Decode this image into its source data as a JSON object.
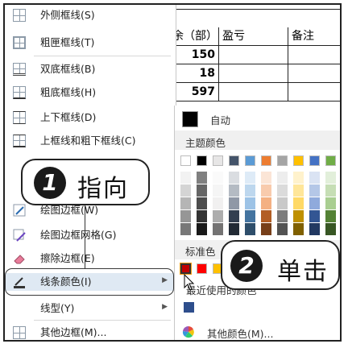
{
  "spreadsheet": {
    "header": [
      "余（部）",
      "盈亏",
      "备注"
    ],
    "rows": [
      [
        "150",
        "",
        ""
      ],
      [
        "18",
        "",
        ""
      ],
      [
        "597",
        "",
        ""
      ]
    ]
  },
  "menu": {
    "items": [
      {
        "label": "外侧框线(S)",
        "icon": "outside-border-icon"
      },
      {
        "label": "粗匣框线(T)",
        "icon": "thick-box-border-icon"
      },
      {
        "label": "双底框线(B)",
        "icon": "double-bottom-border-icon"
      },
      {
        "label": "粗底框线(H)",
        "icon": "thick-bottom-border-icon"
      },
      {
        "label": "上下框线(D)",
        "icon": "top-bottom-border-icon"
      },
      {
        "label": "上框线和粗下框线(C)",
        "icon": "top-thick-bottom-border-icon"
      },
      {
        "label": "绘图边框(W)",
        "icon": "draw-border-icon"
      },
      {
        "label": "绘图边框网格(G)",
        "icon": "draw-border-grid-icon"
      },
      {
        "label": "擦除边框(E)",
        "icon": "eraser-icon"
      },
      {
        "label": "线条颜色(I)",
        "icon": "line-color-icon",
        "submenu": true
      },
      {
        "label": "线型(Y)",
        "icon": "",
        "submenu": true
      },
      {
        "label": "其他边框(M)...",
        "icon": "all-borders-icon"
      }
    ]
  },
  "palette": {
    "auto_label": "自动",
    "theme_label": "主题颜色",
    "standard_label": "标准色",
    "recent_label": "最近使用的颜色",
    "more_label": "其他颜色(M)...",
    "theme_top": [
      "#ffffff",
      "#000000",
      "#e7e6e6",
      "#44546a",
      "#5b9bd5",
      "#ed7d31",
      "#a5a5a5",
      "#ffc000",
      "#4472c4",
      "#70ad47"
    ],
    "standard": [
      "#c00000",
      "#ff0000",
      "#ffc000",
      "#ffff00",
      "#92d050",
      "#00b050",
      "#00b0f0",
      "#0070c0",
      "#002060",
      "#7030a0"
    ],
    "recent": [
      "#2e4e8c"
    ]
  },
  "callouts": {
    "step1": {
      "number": "1",
      "text": "指向"
    },
    "step2": {
      "number": "2",
      "text": "单击"
    }
  }
}
